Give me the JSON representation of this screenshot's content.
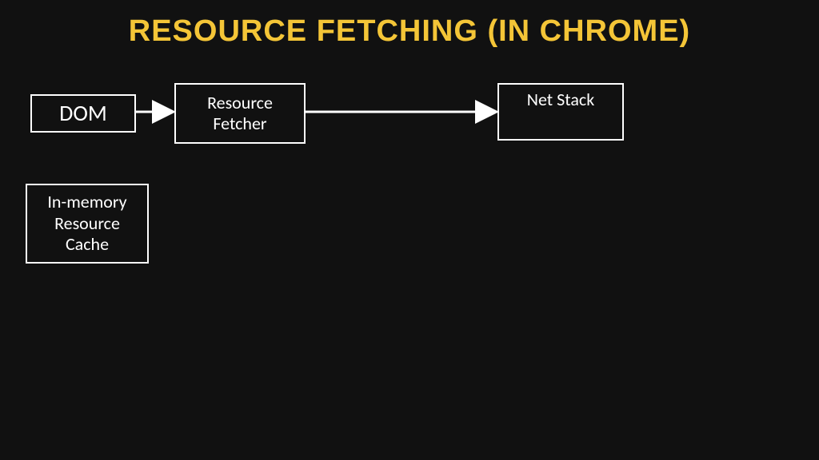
{
  "title": "RESOURCE FETCHING (IN CHROME)",
  "nodes": {
    "dom": "DOM",
    "resource_fetcher": "Resource\nFetcher",
    "net_stack": "Net Stack",
    "in_memory_cache": "In-memory\nResource\nCache"
  },
  "edges": [
    {
      "from": "dom",
      "to": "resource_fetcher"
    },
    {
      "from": "resource_fetcher",
      "to": "net_stack"
    }
  ],
  "colors": {
    "background": "#111111",
    "title": "#f4c537",
    "box_border": "#ffffff",
    "box_text": "#ffffff",
    "arrow": "#ffffff"
  }
}
